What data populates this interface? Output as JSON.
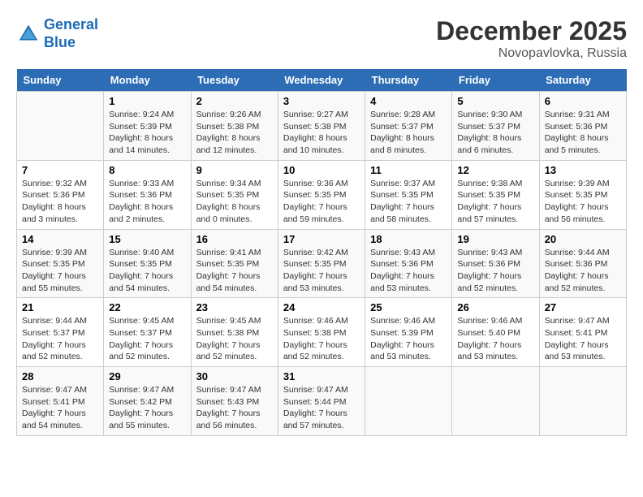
{
  "header": {
    "logo_line1": "General",
    "logo_line2": "Blue",
    "month_title": "December 2025",
    "location": "Novopavlovka, Russia"
  },
  "weekdays": [
    "Sunday",
    "Monday",
    "Tuesday",
    "Wednesday",
    "Thursday",
    "Friday",
    "Saturday"
  ],
  "weeks": [
    [
      {
        "day": "",
        "info": ""
      },
      {
        "day": "1",
        "info": "Sunrise: 9:24 AM\nSunset: 5:39 PM\nDaylight: 8 hours\nand 14 minutes."
      },
      {
        "day": "2",
        "info": "Sunrise: 9:26 AM\nSunset: 5:38 PM\nDaylight: 8 hours\nand 12 minutes."
      },
      {
        "day": "3",
        "info": "Sunrise: 9:27 AM\nSunset: 5:38 PM\nDaylight: 8 hours\nand 10 minutes."
      },
      {
        "day": "4",
        "info": "Sunrise: 9:28 AM\nSunset: 5:37 PM\nDaylight: 8 hours\nand 8 minutes."
      },
      {
        "day": "5",
        "info": "Sunrise: 9:30 AM\nSunset: 5:37 PM\nDaylight: 8 hours\nand 6 minutes."
      },
      {
        "day": "6",
        "info": "Sunrise: 9:31 AM\nSunset: 5:36 PM\nDaylight: 8 hours\nand 5 minutes."
      }
    ],
    [
      {
        "day": "7",
        "info": "Sunrise: 9:32 AM\nSunset: 5:36 PM\nDaylight: 8 hours\nand 3 minutes."
      },
      {
        "day": "8",
        "info": "Sunrise: 9:33 AM\nSunset: 5:36 PM\nDaylight: 8 hours\nand 2 minutes."
      },
      {
        "day": "9",
        "info": "Sunrise: 9:34 AM\nSunset: 5:35 PM\nDaylight: 8 hours\nand 0 minutes."
      },
      {
        "day": "10",
        "info": "Sunrise: 9:36 AM\nSunset: 5:35 PM\nDaylight: 7 hours\nand 59 minutes."
      },
      {
        "day": "11",
        "info": "Sunrise: 9:37 AM\nSunset: 5:35 PM\nDaylight: 7 hours\nand 58 minutes."
      },
      {
        "day": "12",
        "info": "Sunrise: 9:38 AM\nSunset: 5:35 PM\nDaylight: 7 hours\nand 57 minutes."
      },
      {
        "day": "13",
        "info": "Sunrise: 9:39 AM\nSunset: 5:35 PM\nDaylight: 7 hours\nand 56 minutes."
      }
    ],
    [
      {
        "day": "14",
        "info": "Sunrise: 9:39 AM\nSunset: 5:35 PM\nDaylight: 7 hours\nand 55 minutes."
      },
      {
        "day": "15",
        "info": "Sunrise: 9:40 AM\nSunset: 5:35 PM\nDaylight: 7 hours\nand 54 minutes."
      },
      {
        "day": "16",
        "info": "Sunrise: 9:41 AM\nSunset: 5:35 PM\nDaylight: 7 hours\nand 54 minutes."
      },
      {
        "day": "17",
        "info": "Sunrise: 9:42 AM\nSunset: 5:35 PM\nDaylight: 7 hours\nand 53 minutes."
      },
      {
        "day": "18",
        "info": "Sunrise: 9:43 AM\nSunset: 5:36 PM\nDaylight: 7 hours\nand 53 minutes."
      },
      {
        "day": "19",
        "info": "Sunrise: 9:43 AM\nSunset: 5:36 PM\nDaylight: 7 hours\nand 52 minutes."
      },
      {
        "day": "20",
        "info": "Sunrise: 9:44 AM\nSunset: 5:36 PM\nDaylight: 7 hours\nand 52 minutes."
      }
    ],
    [
      {
        "day": "21",
        "info": "Sunrise: 9:44 AM\nSunset: 5:37 PM\nDaylight: 7 hours\nand 52 minutes."
      },
      {
        "day": "22",
        "info": "Sunrise: 9:45 AM\nSunset: 5:37 PM\nDaylight: 7 hours\nand 52 minutes."
      },
      {
        "day": "23",
        "info": "Sunrise: 9:45 AM\nSunset: 5:38 PM\nDaylight: 7 hours\nand 52 minutes."
      },
      {
        "day": "24",
        "info": "Sunrise: 9:46 AM\nSunset: 5:38 PM\nDaylight: 7 hours\nand 52 minutes."
      },
      {
        "day": "25",
        "info": "Sunrise: 9:46 AM\nSunset: 5:39 PM\nDaylight: 7 hours\nand 53 minutes."
      },
      {
        "day": "26",
        "info": "Sunrise: 9:46 AM\nSunset: 5:40 PM\nDaylight: 7 hours\nand 53 minutes."
      },
      {
        "day": "27",
        "info": "Sunrise: 9:47 AM\nSunset: 5:41 PM\nDaylight: 7 hours\nand 53 minutes."
      }
    ],
    [
      {
        "day": "28",
        "info": "Sunrise: 9:47 AM\nSunset: 5:41 PM\nDaylight: 7 hours\nand 54 minutes."
      },
      {
        "day": "29",
        "info": "Sunrise: 9:47 AM\nSunset: 5:42 PM\nDaylight: 7 hours\nand 55 minutes."
      },
      {
        "day": "30",
        "info": "Sunrise: 9:47 AM\nSunset: 5:43 PM\nDaylight: 7 hours\nand 56 minutes."
      },
      {
        "day": "31",
        "info": "Sunrise: 9:47 AM\nSunset: 5:44 PM\nDaylight: 7 hours\nand 57 minutes."
      },
      {
        "day": "",
        "info": ""
      },
      {
        "day": "",
        "info": ""
      },
      {
        "day": "",
        "info": ""
      }
    ]
  ]
}
